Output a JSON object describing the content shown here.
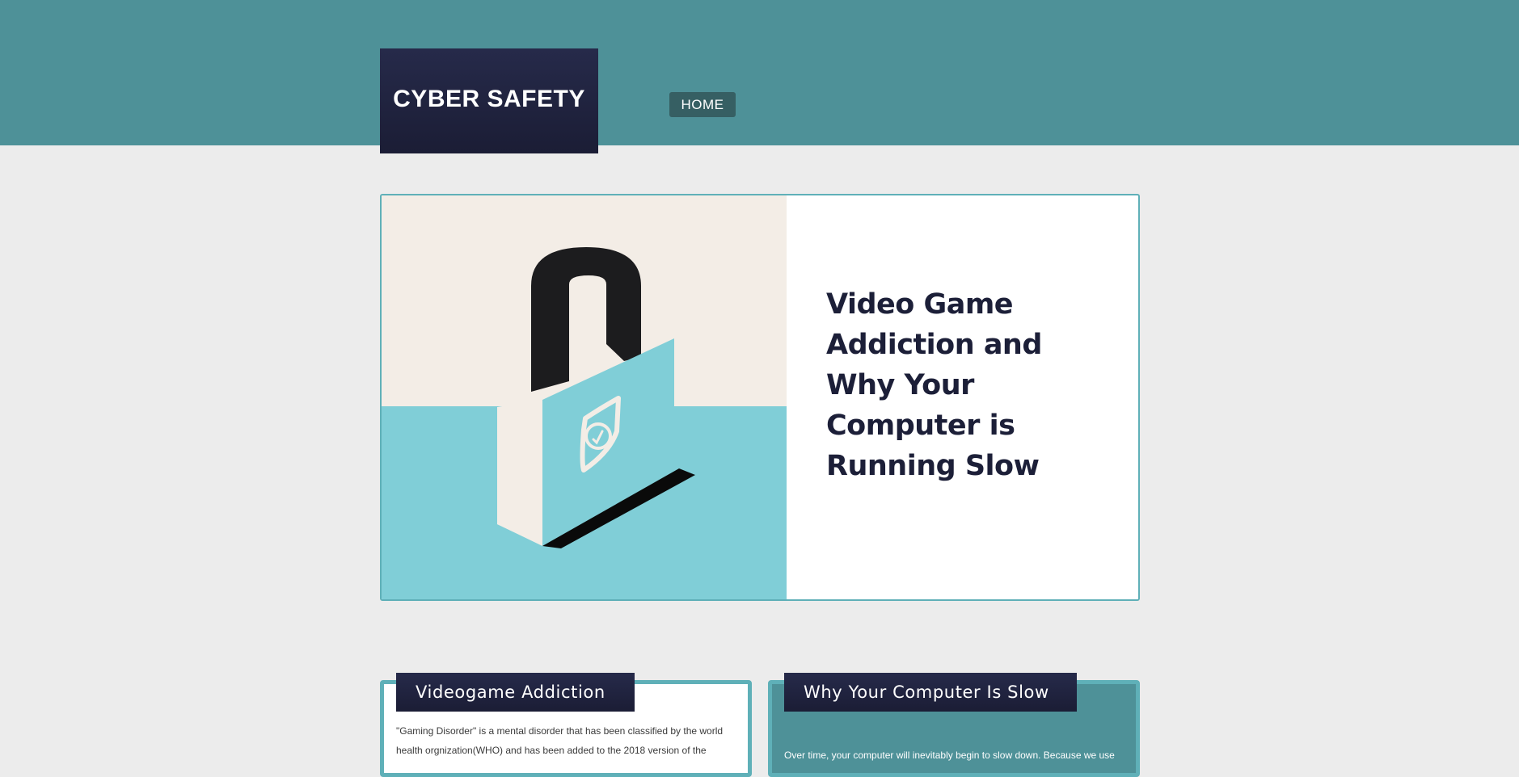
{
  "header": {
    "logo_text": "CYBER SAFETY",
    "nav": {
      "home_label": "HOME"
    }
  },
  "hero": {
    "title": "Video Game Addiction and Why Your Computer is Running Slow",
    "image_icon": "padlock-shield-illustration"
  },
  "cards": {
    "left": {
      "title": "Videogame Addiction",
      "body": "\"Gaming Disorder\" is a mental disorder that has been classified by the world health orgnization(WHO) and has been added to the 2018 version of the"
    },
    "right": {
      "title": "Why Your Computer Is Slow",
      "body": "Over time, your computer will inevitably begin to slow down. Because we use"
    }
  },
  "colors": {
    "header_band": "#4e9198",
    "logo_bg": "#1f2240",
    "nav_button": "#365f63",
    "page_bg": "#ececec",
    "accent_border": "#5fb0b8",
    "hero_art_cream": "#f3ede6",
    "hero_art_teal": "#80ced7",
    "title_text": "#1c1f38"
  }
}
